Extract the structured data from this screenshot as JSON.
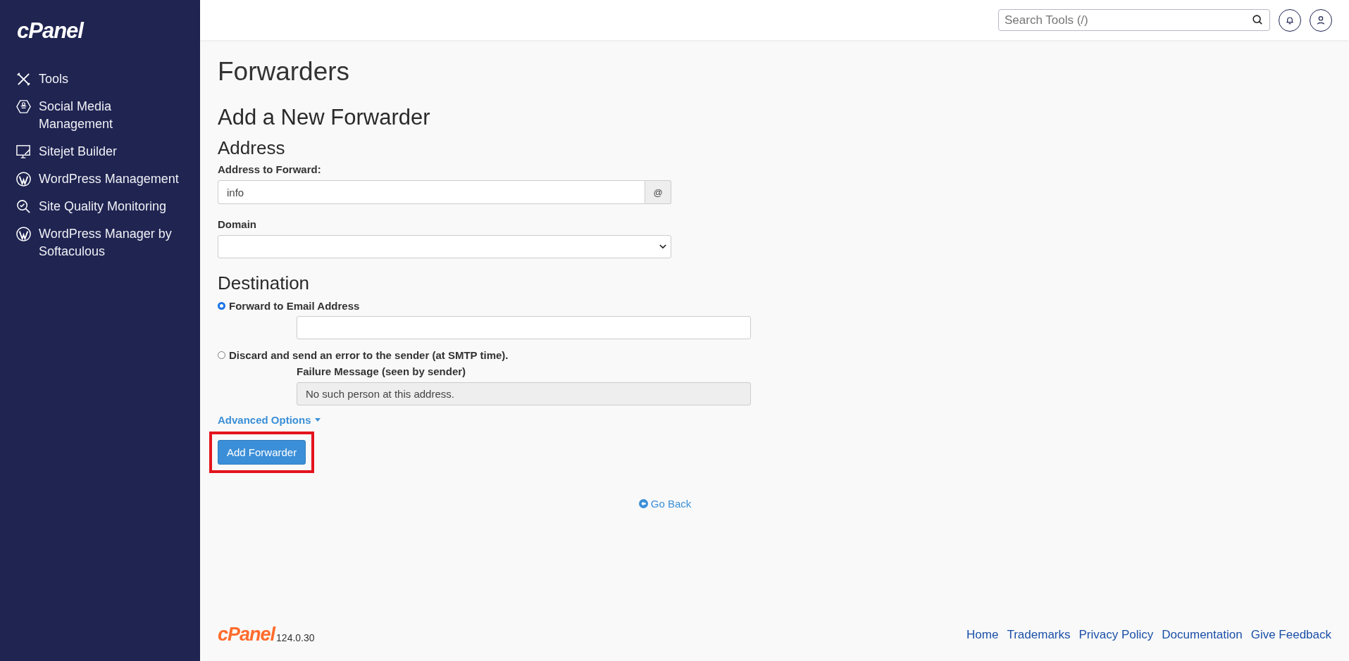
{
  "sidebar": {
    "logo": "cPanel",
    "items": [
      {
        "label": "Tools",
        "kind": "tools"
      },
      {
        "label": "Social Media Management",
        "kind": "social"
      },
      {
        "label": "Sitejet Builder",
        "kind": "sitejet"
      },
      {
        "label": "WordPress Management",
        "kind": "wordpress"
      },
      {
        "label": "Site Quality Monitoring",
        "kind": "quality"
      },
      {
        "label": "WordPress Manager by Softaculous",
        "kind": "wordpress"
      }
    ]
  },
  "header": {
    "search": {
      "placeholder": "Search Tools (/)"
    }
  },
  "page_title": "Forwarders",
  "form": {
    "title": "Add a New Forwarder",
    "address_section": "Address",
    "address_label": "Address to Forward:",
    "address_value": "info",
    "address_addon": "@",
    "domain_label": "Domain",
    "destination_section": "Destination",
    "options": [
      {
        "label": "Forward to Email Address",
        "selected": true,
        "kind": "email"
      },
      {
        "label": "Discard and send an error to the sender (at SMTP time).",
        "selected": false,
        "kind": "failure",
        "sublabel": "Failure Message (seen by sender)",
        "value": "No such person at this address."
      }
    ],
    "advanced": "Advanced Options",
    "submit": "Add Forwarder",
    "submit_highlighted": true
  },
  "go_back": "Go Back",
  "footer": {
    "logo": "cPanel",
    "version": "124.0.30",
    "links": [
      "Home",
      "Trademarks",
      "Privacy Policy",
      "Documentation",
      "Give Feedback"
    ]
  }
}
